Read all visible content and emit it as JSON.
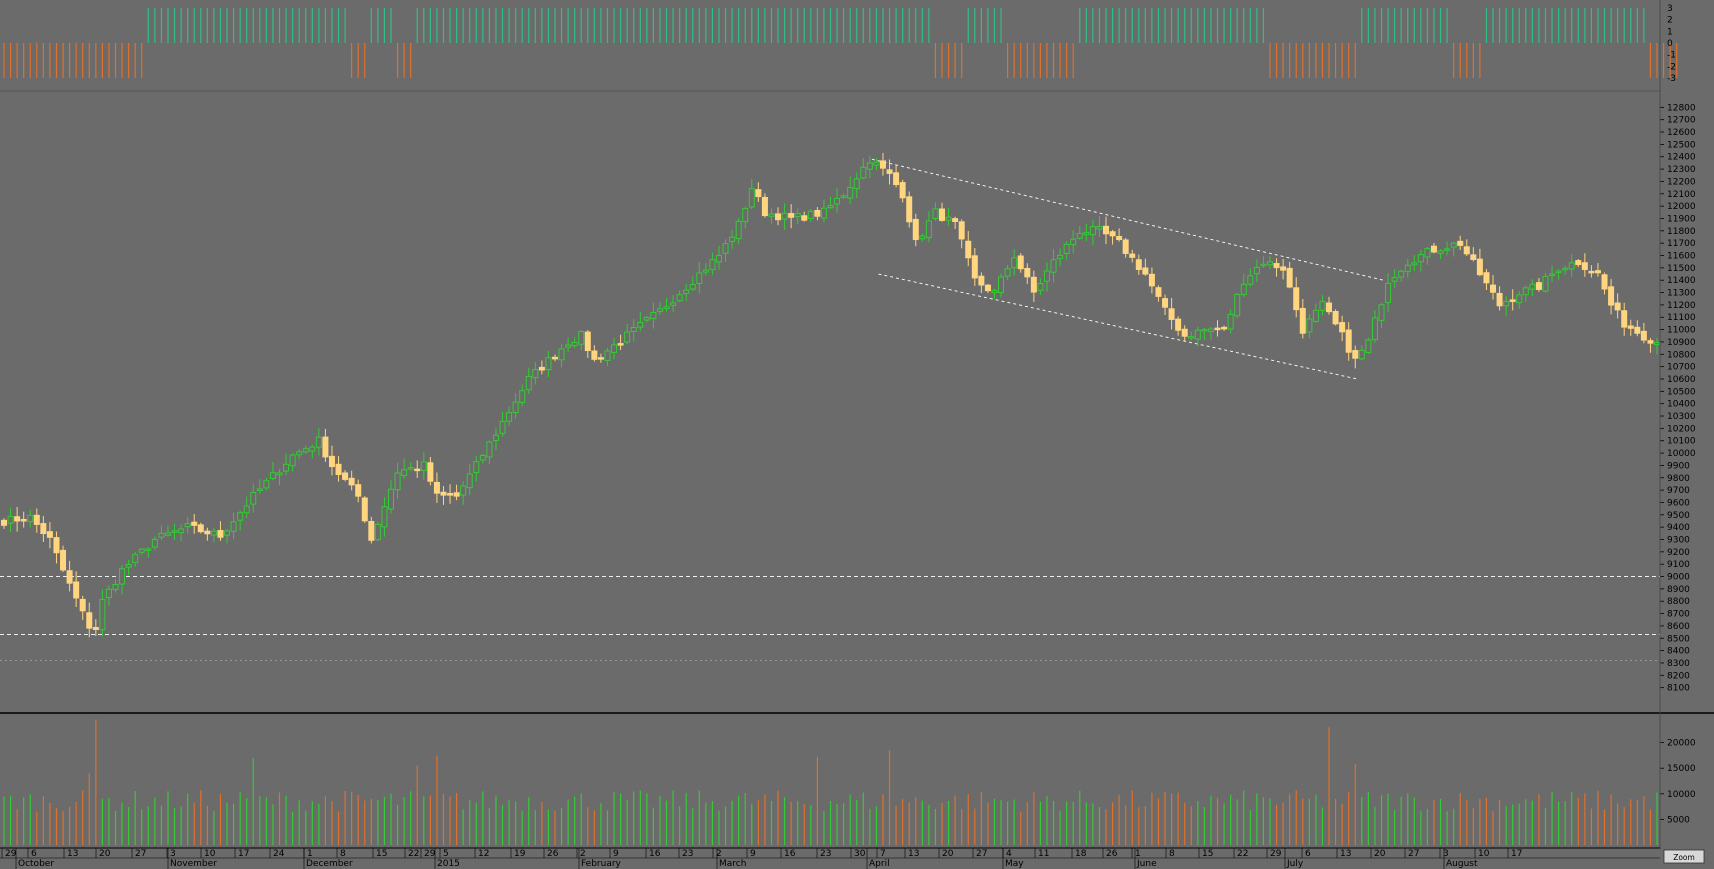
{
  "colors": {
    "background": "#6b6b6b",
    "up": "#33cc33",
    "down": "#ffd580",
    "osc_pos": "#2fbf86",
    "osc_neg": "#e0702a",
    "vol_up": "#33cc33",
    "vol_down": "#e0702a",
    "guide": "#ffffff"
  },
  "chart_data": [
    {
      "type": "bar",
      "panel": "oscillator",
      "ylim": [
        -3,
        3
      ],
      "yticks": [
        3,
        2,
        1,
        0,
        -1,
        -2,
        -3
      ],
      "segments": [
        {
          "from_bar": 0,
          "to_bar": 21,
          "value": -3
        },
        {
          "from_bar": 22,
          "to_bar": 52,
          "value": 3
        },
        {
          "from_bar": 53,
          "to_bar": 55,
          "value": -3
        },
        {
          "from_bar": 56,
          "to_bar": 59,
          "value": 3
        },
        {
          "from_bar": 60,
          "to_bar": 62,
          "value": -3
        },
        {
          "from_bar": 63,
          "to_bar": 141,
          "value": 3
        },
        {
          "from_bar": 142,
          "to_bar": 146,
          "value": -3
        },
        {
          "from_bar": 147,
          "to_bar": 152,
          "value": 3
        },
        {
          "from_bar": 153,
          "to_bar": 163,
          "value": -3
        },
        {
          "from_bar": 164,
          "to_bar": 175,
          "value": 3
        },
        {
          "from_bar": 176,
          "to_bar": 186,
          "value": 3
        },
        {
          "from_bar": 187,
          "to_bar": 192,
          "value": 3
        },
        {
          "from_bar": 193,
          "to_bar": 206,
          "value": -3
        },
        {
          "from_bar": 207,
          "to_bar": 210,
          "value": 3
        },
        {
          "from_bar": 211,
          "to_bar": 220,
          "value": 3
        },
        {
          "from_bar": 221,
          "to_bar": 225,
          "value": -3
        },
        {
          "from_bar": 226,
          "to_bar": 239,
          "value": 3
        },
        {
          "from_bar": 240,
          "to_bar": 250,
          "value": 3
        },
        {
          "from_bar": 251,
          "to_bar": 255,
          "value": -3
        }
      ]
    },
    {
      "type": "candlestick",
      "panel": "price",
      "ylim": [
        8000,
        12900
      ],
      "yticks": [
        12800,
        12700,
        12600,
        12500,
        12400,
        12300,
        12200,
        12100,
        12000,
        11900,
        11800,
        11700,
        11600,
        11500,
        11400,
        11300,
        11200,
        11100,
        11000,
        10900,
        10800,
        10700,
        10600,
        10500,
        10400,
        10300,
        10200,
        10100,
        10000,
        9900,
        9800,
        9700,
        9600,
        9500,
        9400,
        9300,
        9200,
        9100,
        9000,
        8900,
        8800,
        8700,
        8600,
        8500,
        8400,
        8300,
        8200,
        8100
      ],
      "horizontal_lines": [
        9000,
        8530,
        8320
      ],
      "trend_lines": [
        {
          "x": [
            "2015-04-13",
            "2015-07-13"
          ],
          "y": [
            12380,
            11400
          ]
        },
        {
          "x": [
            "2015-04-08",
            "2015-07-06"
          ],
          "y": [
            11450,
            10600
          ]
        }
      ],
      "waypoints": [
        [
          0,
          9450
        ],
        [
          4,
          9480
        ],
        [
          7,
          9300
        ],
        [
          9,
          9050
        ],
        [
          12,
          8700
        ],
        [
          13,
          8600
        ],
        [
          14,
          8580
        ],
        [
          15,
          8800
        ],
        [
          18,
          9050
        ],
        [
          23,
          9300
        ],
        [
          28,
          9400
        ],
        [
          33,
          9330
        ],
        [
          38,
          9650
        ],
        [
          44,
          9980
        ],
        [
          48,
          10100
        ],
        [
          50,
          9900
        ],
        [
          54,
          9650
        ],
        [
          56,
          9300
        ],
        [
          60,
          9850
        ],
        [
          64,
          9900
        ],
        [
          66,
          9650
        ],
        [
          69,
          9650
        ],
        [
          72,
          9900
        ],
        [
          76,
          10250
        ],
        [
          80,
          10600
        ],
        [
          83,
          10750
        ],
        [
          86,
          10900
        ],
        [
          88,
          10950
        ],
        [
          90,
          10750
        ],
        [
          95,
          10950
        ],
        [
          100,
          11150
        ],
        [
          104,
          11350
        ],
        [
          109,
          11600
        ],
        [
          112,
          11850
        ],
        [
          114,
          12150
        ],
        [
          116,
          11950
        ],
        [
          120,
          11900
        ],
        [
          125,
          11950
        ],
        [
          128,
          12100
        ],
        [
          132,
          12380
        ],
        [
          135,
          12250
        ],
        [
          137,
          12100
        ],
        [
          139,
          11700
        ],
        [
          142,
          11950
        ],
        [
          145,
          11850
        ],
        [
          148,
          11400
        ],
        [
          151,
          11300
        ],
        [
          154,
          11600
        ],
        [
          157,
          11300
        ],
        [
          160,
          11550
        ],
        [
          164,
          11800
        ],
        [
          167,
          11800
        ],
        [
          170,
          11700
        ],
        [
          174,
          11450
        ],
        [
          177,
          11150
        ],
        [
          180,
          10950
        ],
        [
          183,
          11000
        ],
        [
          186,
          11000
        ],
        [
          189,
          11400
        ],
        [
          192,
          11550
        ],
        [
          195,
          11500
        ],
        [
          198,
          11000
        ],
        [
          201,
          11200
        ],
        [
          204,
          10950
        ],
        [
          206,
          10750
        ],
        [
          208,
          10900
        ],
        [
          211,
          11400
        ],
        [
          214,
          11550
        ],
        [
          218,
          11650
        ],
        [
          222,
          11700
        ],
        [
          225,
          11450
        ],
        [
          228,
          11200
        ],
        [
          231,
          11300
        ],
        [
          234,
          11350
        ],
        [
          237,
          11500
        ],
        [
          240,
          11550
        ],
        [
          243,
          11450
        ],
        [
          245,
          11200
        ],
        [
          247,
          11050
        ],
        [
          250,
          10950
        ],
        [
          252,
          10900
        ]
      ],
      "bar_count": 253
    },
    {
      "type": "bar",
      "panel": "volume",
      "ylim": [
        0,
        25000
      ],
      "yticks": [
        20000,
        15000,
        10000,
        5000
      ],
      "base": 8200,
      "spikes": [
        [
          14,
          24500
        ],
        [
          13,
          14000
        ],
        [
          63,
          15500
        ],
        [
          66,
          17500
        ],
        [
          135,
          18500
        ],
        [
          202,
          23000
        ],
        [
          206,
          15800
        ],
        [
          38,
          17000
        ],
        [
          124,
          17200
        ]
      ]
    }
  ],
  "axis": {
    "days": [
      "29",
      "6",
      "13",
      "20",
      "27",
      "3",
      "10",
      "17",
      "24",
      "1",
      "8",
      "15",
      "22",
      "29",
      "5",
      "12",
      "19",
      "26",
      "2",
      "9",
      "16",
      "23",
      "2",
      "9",
      "16",
      "23",
      "30",
      "7",
      "13",
      "20",
      "27",
      "4",
      "11",
      "18",
      "26",
      "1",
      "8",
      "15",
      "22",
      "29",
      "6",
      "13",
      "20",
      "27",
      "3",
      "10",
      "17"
    ],
    "months": [
      "October",
      "November",
      "December",
      "2015",
      "February",
      "March",
      "April",
      "May",
      "June",
      "July",
      "August"
    ],
    "zoom": "Zoom"
  }
}
